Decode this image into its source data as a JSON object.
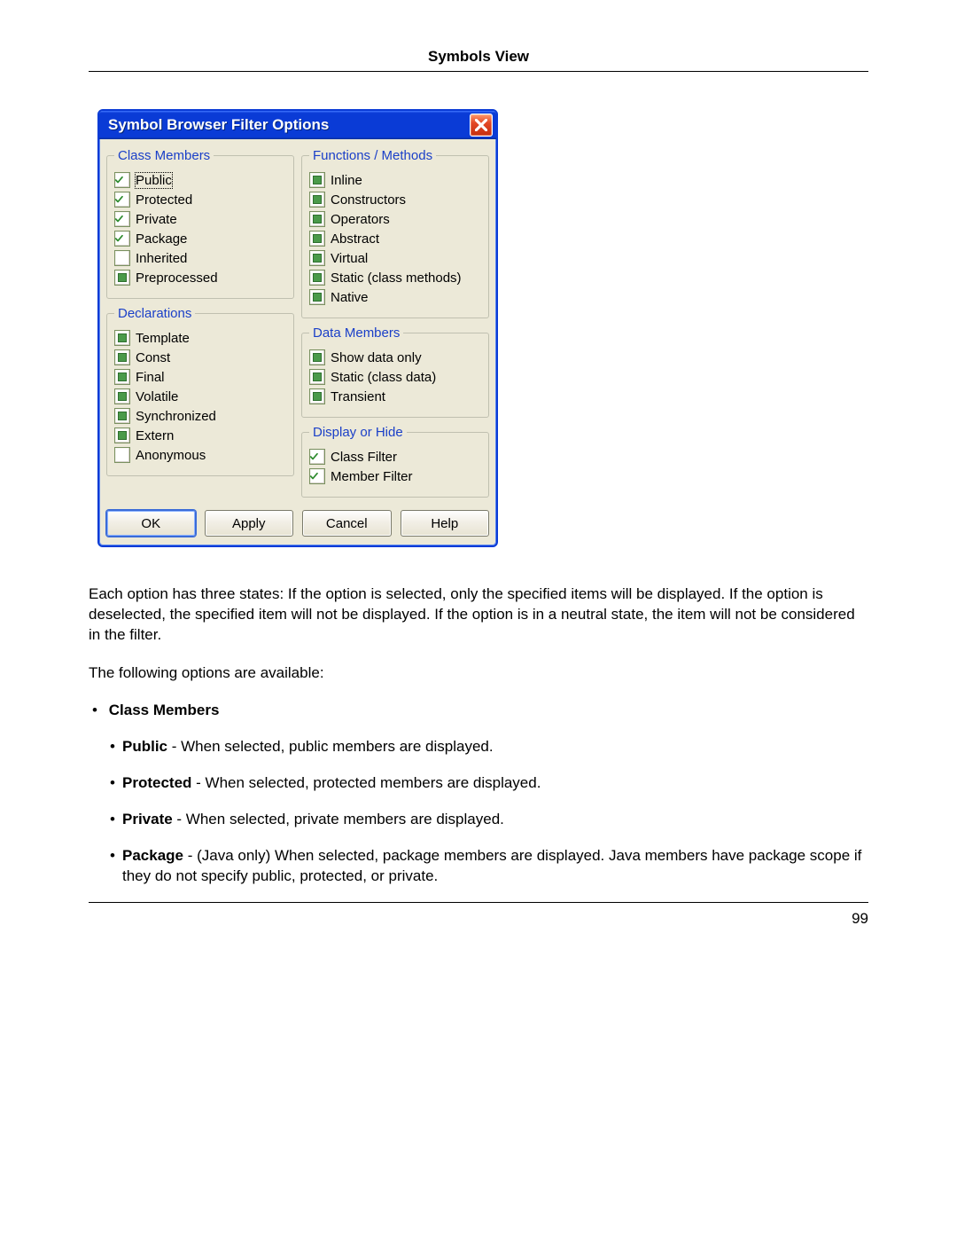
{
  "header": "Symbols View",
  "page_number": "99",
  "dialog": {
    "title": "Symbol Browser Filter Options",
    "groups": {
      "class_members": {
        "legend": "Class Members",
        "items": [
          {
            "label": "Public",
            "state": "checked",
            "focused": true
          },
          {
            "label": "Protected",
            "state": "checked"
          },
          {
            "label": "Private",
            "state": "checked"
          },
          {
            "label": "Package",
            "state": "checked"
          },
          {
            "label": "Inherited",
            "state": "empty"
          },
          {
            "label": "Preprocessed",
            "state": "partial"
          }
        ]
      },
      "declarations": {
        "legend": "Declarations",
        "items": [
          {
            "label": "Template",
            "state": "partial"
          },
          {
            "label": "Const",
            "state": "partial"
          },
          {
            "label": "Final",
            "state": "partial"
          },
          {
            "label": "Volatile",
            "state": "partial"
          },
          {
            "label": "Synchronized",
            "state": "partial"
          },
          {
            "label": "Extern",
            "state": "partial"
          },
          {
            "label": "Anonymous",
            "state": "empty"
          }
        ]
      },
      "functions": {
        "legend": "Functions / Methods",
        "items": [
          {
            "label": "Inline",
            "state": "partial"
          },
          {
            "label": "Constructors",
            "state": "partial"
          },
          {
            "label": "Operators",
            "state": "partial"
          },
          {
            "label": "Abstract",
            "state": "partial"
          },
          {
            "label": "Virtual",
            "state": "partial"
          },
          {
            "label": "Static (class methods)",
            "state": "partial"
          },
          {
            "label": "Native",
            "state": "partial"
          }
        ]
      },
      "data_members": {
        "legend": "Data Members",
        "items": [
          {
            "label": "Show data only",
            "state": "partial"
          },
          {
            "label": "Static (class data)",
            "state": "partial"
          },
          {
            "label": "Transient",
            "state": "partial"
          }
        ]
      },
      "display": {
        "legend": "Display or Hide",
        "items": [
          {
            "label": "Class Filter",
            "state": "checked"
          },
          {
            "label": "Member Filter",
            "state": "checked"
          }
        ]
      }
    },
    "buttons": {
      "ok": "OK",
      "apply": "Apply",
      "cancel": "Cancel",
      "help": "Help"
    }
  },
  "para1": "Each option has three states: If the option is selected, only the specified items will be displayed. If the option is deselected, the specified item will not be displayed. If the option is in a neutral state, the item will not be considered in the filter.",
  "para2": "The following options are available:",
  "list_heading": "Class Members",
  "sub_items": [
    {
      "term": "Public",
      "desc": " - When selected, public members are displayed."
    },
    {
      "term": "Protected",
      "desc": " - When selected, protected members are displayed."
    },
    {
      "term": "Private",
      "desc": " - When selected, private members are displayed."
    },
    {
      "term": "Package",
      "desc": " - (Java only) When selected, package members are displayed. Java members have package scope if they do not specify public, protected, or private."
    }
  ]
}
